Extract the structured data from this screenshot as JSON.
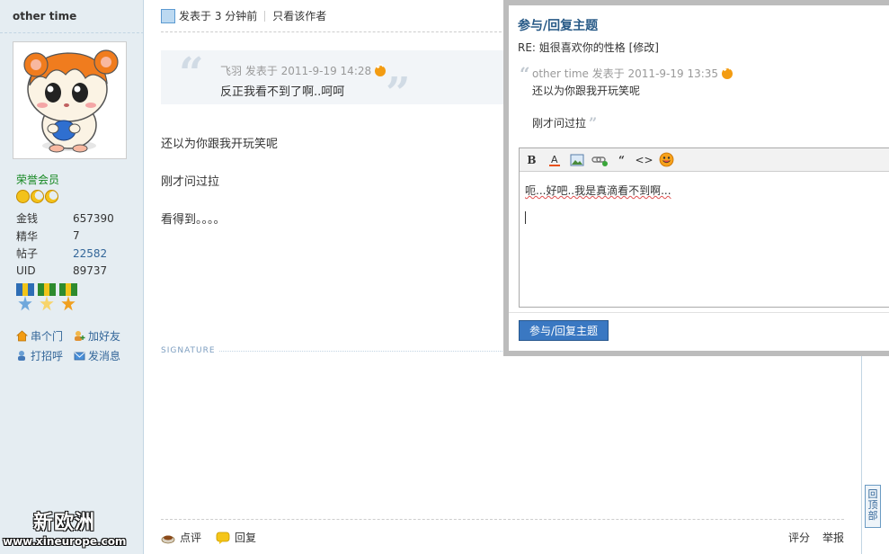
{
  "user": {
    "name": "other time",
    "rank": "荣誉会员",
    "stats": [
      {
        "key": "金钱",
        "value": "657390"
      },
      {
        "key": "精华",
        "value": "7"
      },
      {
        "key": "帖子",
        "value": "22582"
      },
      {
        "key": "UID",
        "value": "89737"
      }
    ],
    "actions": {
      "visit": "串个门",
      "add_friend": "加好友",
      "poke": "打招呼",
      "message": "发消息"
    }
  },
  "watermark": {
    "title": "新欧洲",
    "url": "www.xineurope.com"
  },
  "post": {
    "posted": "发表于 3 分钟前",
    "only_author": "只看该作者",
    "quote": {
      "meta": "飞羽 发表于 2011-9-19 14:28",
      "text": "反正我看不到了啊..呵呵"
    },
    "lines": [
      "还以为你跟我开玩笑呢",
      "刚才问过拉",
      "看得到。。。。"
    ],
    "signature_label": "SIGNATURE",
    "footer": {
      "comment": "点评",
      "reply": "回复",
      "rate": "评分",
      "report": "举报"
    }
  },
  "back_to_top": "回顶部",
  "reply_popup": {
    "title": "参与/回复主题",
    "subject": "RE: 姐很喜欢你的性格 [修改]",
    "quote_meta": "other time 发表于 2011-9-19 13:35",
    "quote_lines": [
      "还以为你跟我开玩笑呢",
      "刚才问过拉"
    ],
    "editor_text": "呃...好吧..我是真滴看不到啊...",
    "submit": "参与/回复主题"
  },
  "colors": {
    "sidebar_bg": "#e5edf2",
    "link": "#336699",
    "rank_green": "#13871f",
    "button_blue": "#3a78c2"
  }
}
